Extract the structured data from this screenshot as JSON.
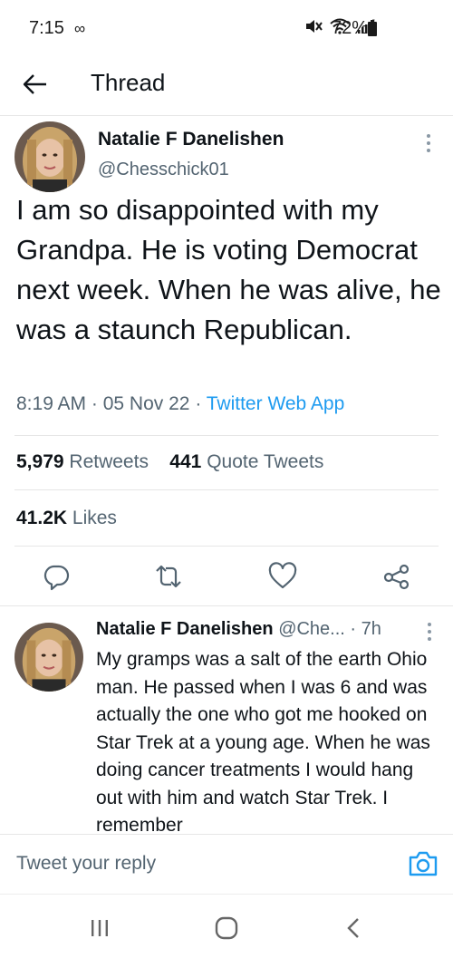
{
  "status_bar": {
    "time": "7:15",
    "infinity": "∞",
    "battery": "72%"
  },
  "header": {
    "title": "Thread"
  },
  "tweet": {
    "author_name": "Natalie F Danelishen",
    "author_handle": "@Chesschick01",
    "text": "I am so disappointed with my Grandpa. He is voting Democrat next week. When he was alive, he was a staunch Republican.",
    "time": "8:19 AM",
    "date": "05 Nov 22",
    "client": "Twitter Web App",
    "retweets_count": "5,979",
    "retweets_label": "Retweets",
    "quotes_count": "441",
    "quotes_label": "Quote Tweets",
    "likes_count": "41.2K",
    "likes_label": "Likes"
  },
  "reply": {
    "author_name": "Natalie F Danelishen",
    "author_handle": "@Che...",
    "age": "7h",
    "text": "My gramps was a salt of the earth Ohio man. He passed when I was 6 and was actually the one who got me hooked on Star Trek at a young age. When he was doing cancer treatments I would hang out with him and watch Star Trek. I remember"
  },
  "composer": {
    "placeholder": "Tweet your reply"
  },
  "icons": {
    "back": "arrow-left-icon",
    "more": "more-vertical-icon",
    "reply": "reply-icon",
    "retweet": "retweet-icon",
    "like": "heart-icon",
    "share": "share-icon",
    "camera": "camera-icon",
    "nav_recents": "recents-icon",
    "nav_home": "home-icon",
    "nav_back": "back-chevron-icon"
  },
  "colors": {
    "accent": "#1d9bf0",
    "text": "#0f1419",
    "secondary": "#536471",
    "divider": "#e6e6e6"
  }
}
